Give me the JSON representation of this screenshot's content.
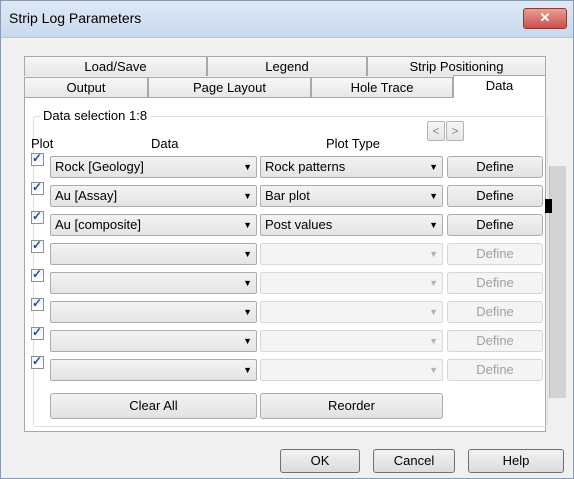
{
  "window": {
    "title": "Strip Log Parameters",
    "close_label": "✕"
  },
  "tabs_back": [
    {
      "label": "Load/Save"
    },
    {
      "label": "Legend"
    },
    {
      "label": "Strip Positioning"
    }
  ],
  "tabs_front": [
    {
      "label": "Output"
    },
    {
      "label": "Page Layout"
    },
    {
      "label": "Hole Trace"
    },
    {
      "label": "Data",
      "active": true
    }
  ],
  "group": {
    "label": "Data selection 1:8",
    "col_plot": "Plot",
    "col_data": "Data",
    "col_plot_type": "Plot Type",
    "prev_label": "<",
    "next_label": ">"
  },
  "rows": [
    {
      "checked": true,
      "data": "Rock [Geology]",
      "plot_type": "Rock patterns",
      "define": "Define",
      "enabled": true
    },
    {
      "checked": true,
      "data": "Au [Assay]",
      "plot_type": "Bar plot",
      "define": "Define",
      "enabled": true
    },
    {
      "checked": true,
      "data": "Au [composite]",
      "plot_type": "Post values",
      "define": "Define",
      "enabled": true
    },
    {
      "checked": true,
      "data": "",
      "plot_type": "",
      "define": "Define",
      "enabled": false
    },
    {
      "checked": true,
      "data": "",
      "plot_type": "",
      "define": "Define",
      "enabled": false
    },
    {
      "checked": true,
      "data": "",
      "plot_type": "",
      "define": "Define",
      "enabled": false
    },
    {
      "checked": true,
      "data": "",
      "plot_type": "",
      "define": "Define",
      "enabled": false
    },
    {
      "checked": true,
      "data": "",
      "plot_type": "",
      "define": "Define",
      "enabled": false
    }
  ],
  "actions": {
    "clear_all": "Clear All",
    "reorder": "Reorder"
  },
  "footer": {
    "ok": "OK",
    "cancel": "Cancel",
    "help": "Help"
  }
}
